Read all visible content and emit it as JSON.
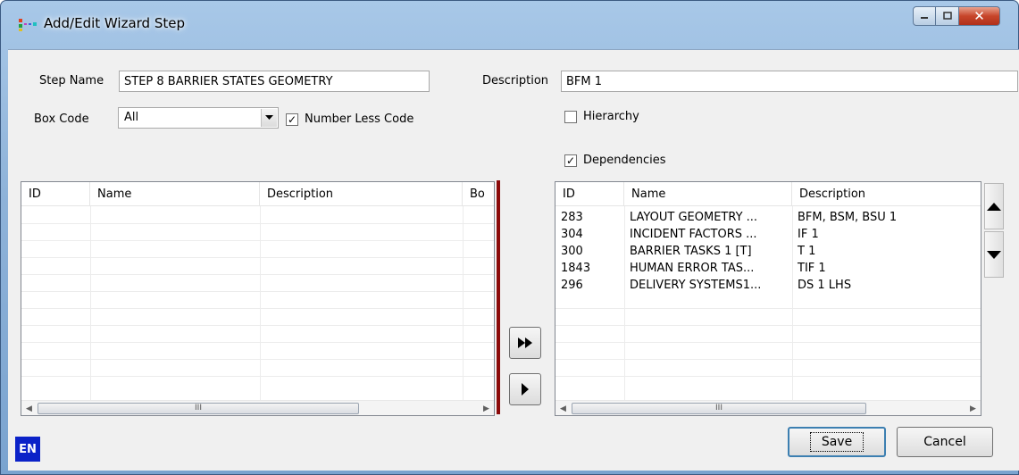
{
  "window": {
    "title": "Add/Edit Wizard Step"
  },
  "form": {
    "step_name_label": "Step Name",
    "step_name_value": "STEP 8 BARRIER STATES GEOMETRY",
    "description_label": "Description",
    "description_value": "BFM 1",
    "box_code_label": "Box Code",
    "box_code_value": "All",
    "number_less_code_label": "Number Less Code",
    "number_less_code_checked": true,
    "hierarchy_label": "Hierarchy",
    "hierarchy_checked": false,
    "dependencies_label": "Dependencies",
    "dependencies_checked": true
  },
  "left_list": {
    "columns": [
      "ID",
      "Name",
      "Description",
      "Bo"
    ],
    "scroll_thumb_label": "III"
  },
  "right_list": {
    "columns": [
      "ID",
      "Name",
      "Description"
    ],
    "rows": [
      {
        "id": "283",
        "name": "LAYOUT GEOMETRY ...",
        "description": "BFM, BSM, BSU 1"
      },
      {
        "id": "304",
        "name": "INCIDENT FACTORS ...",
        "description": "IF 1"
      },
      {
        "id": "300",
        "name": "BARRIER TASKS 1 [T]",
        "description": "T 1"
      },
      {
        "id": "1843",
        "name": "HUMAN ERROR TAS...",
        "description": "TIF 1"
      },
      {
        "id": "296",
        "name": "DELIVERY SYSTEMS1...",
        "description": "DS 1 LHS"
      }
    ],
    "scroll_thumb_label": "III"
  },
  "buttons": {
    "save_label": "Save",
    "cancel_label": "Cancel",
    "language_badge": "EN"
  },
  "icons": [
    "app-icon",
    "minimize-icon",
    "maximize-icon",
    "close-icon",
    "dropdown-arrow-icon",
    "move-all-icon",
    "move-one-icon",
    "move-up-icon",
    "move-down-icon"
  ]
}
